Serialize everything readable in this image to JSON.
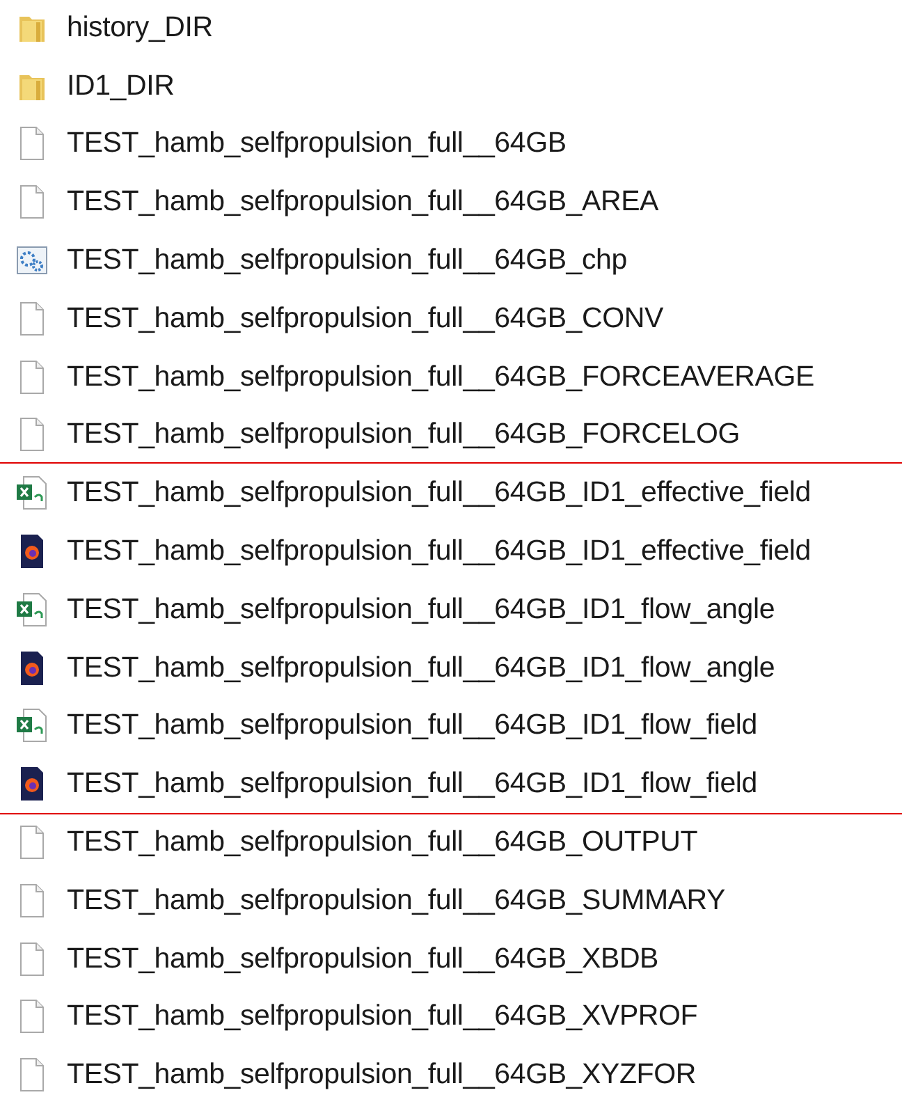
{
  "groups": [
    {
      "outlined": false,
      "items": [
        {
          "kind": "folder",
          "name": "history_DIR"
        },
        {
          "kind": "folder",
          "name": "ID1_DIR"
        },
        {
          "kind": "file",
          "name": "TEST_hamb_selfpropulsion_full__64GB"
        },
        {
          "kind": "file",
          "name": "TEST_hamb_selfpropulsion_full__64GB_AREA"
        },
        {
          "kind": "config",
          "name": "TEST_hamb_selfpropulsion_full__64GB_chp"
        },
        {
          "kind": "file",
          "name": "TEST_hamb_selfpropulsion_full__64GB_CONV"
        },
        {
          "kind": "file",
          "name": "TEST_hamb_selfpropulsion_full__64GB_FORCEAVERAGE"
        },
        {
          "kind": "file",
          "name": "TEST_hamb_selfpropulsion_full__64GB_FORCELOG"
        }
      ]
    },
    {
      "outlined": true,
      "items": [
        {
          "kind": "csv",
          "name": "TEST_hamb_selfpropulsion_full__64GB_ID1_effective_field"
        },
        {
          "kind": "browser",
          "name": "TEST_hamb_selfpropulsion_full__64GB_ID1_effective_field"
        },
        {
          "kind": "csv",
          "name": "TEST_hamb_selfpropulsion_full__64GB_ID1_flow_angle"
        },
        {
          "kind": "browser",
          "name": "TEST_hamb_selfpropulsion_full__64GB_ID1_flow_angle"
        },
        {
          "kind": "csv",
          "name": "TEST_hamb_selfpropulsion_full__64GB_ID1_flow_field"
        },
        {
          "kind": "browser",
          "name": "TEST_hamb_selfpropulsion_full__64GB_ID1_flow_field"
        }
      ]
    },
    {
      "outlined": false,
      "items": [
        {
          "kind": "file",
          "name": "TEST_hamb_selfpropulsion_full__64GB_OUTPUT"
        },
        {
          "kind": "file",
          "name": "TEST_hamb_selfpropulsion_full__64GB_SUMMARY"
        },
        {
          "kind": "file",
          "name": "TEST_hamb_selfpropulsion_full__64GB_XBDB"
        },
        {
          "kind": "file",
          "name": "TEST_hamb_selfpropulsion_full__64GB_XVPROF"
        },
        {
          "kind": "file",
          "name": "TEST_hamb_selfpropulsion_full__64GB_XYZFOR"
        }
      ]
    }
  ]
}
